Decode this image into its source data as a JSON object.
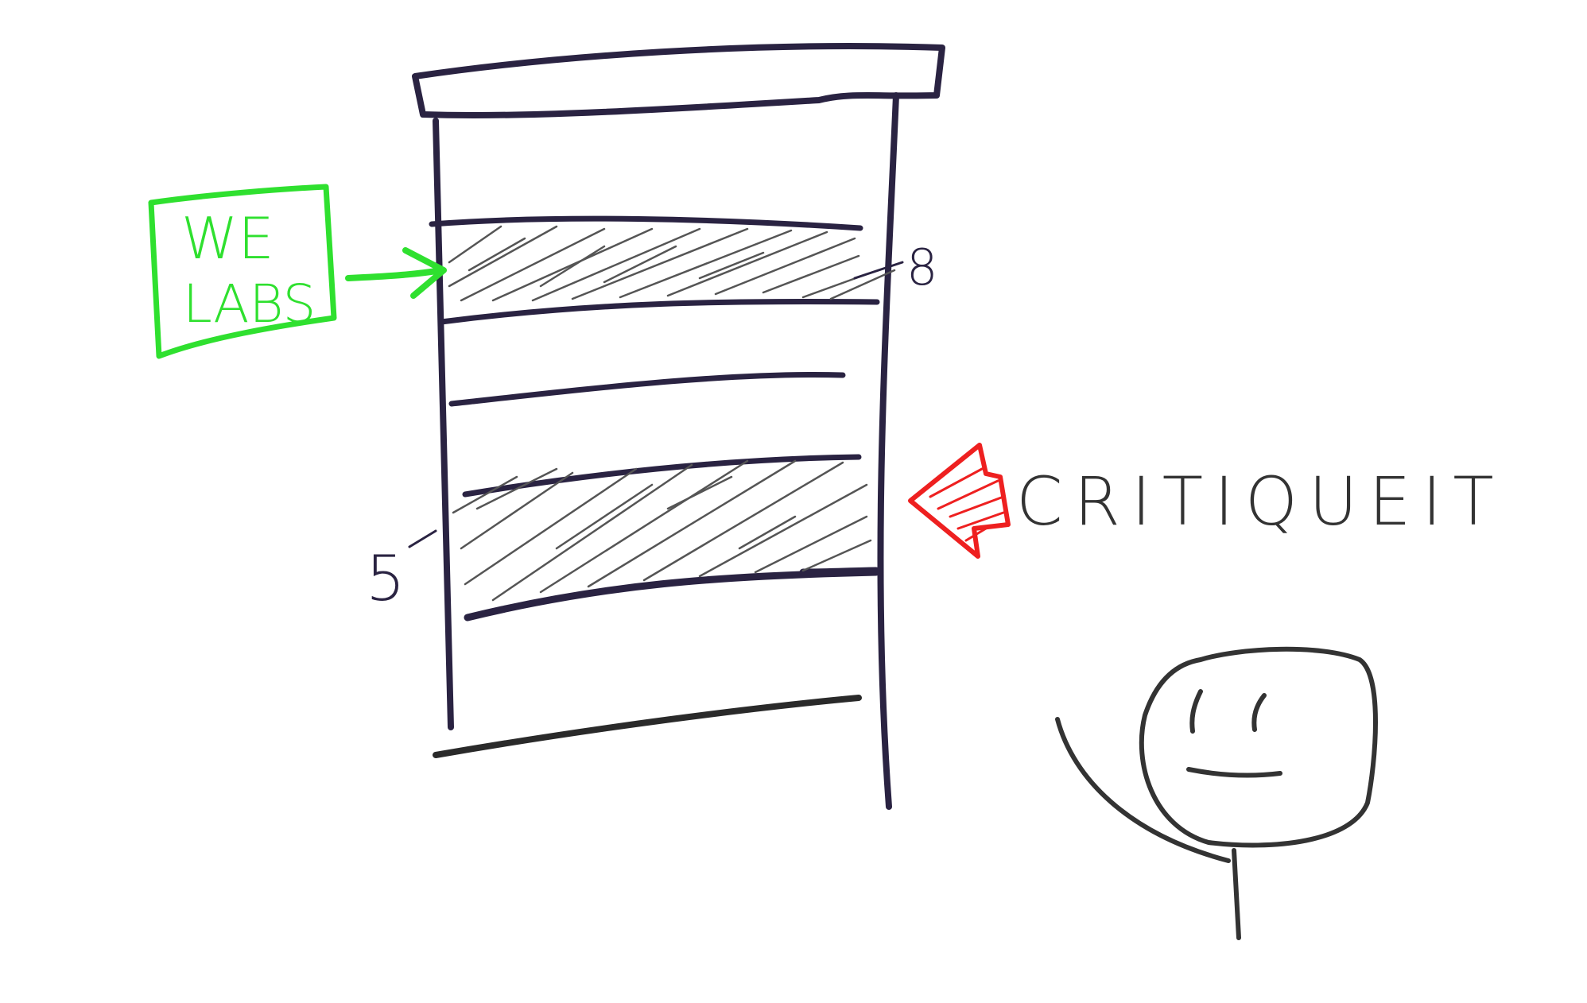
{
  "labels": {
    "we_labs_line1": "WE",
    "we_labs_line2": "LABS",
    "floor_upper": "8",
    "floor_lower": "5",
    "critiqueit": "CRITIQUEIT"
  },
  "colors": {
    "building": "#2a2342",
    "hatch": "#555555",
    "we_labs": "#2fe02f",
    "critiqueit_arrow": "#ee2020",
    "critiqueit_text": "#333333",
    "person": "#333333"
  }
}
